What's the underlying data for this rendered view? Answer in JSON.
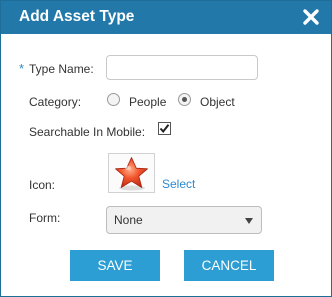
{
  "dialog": {
    "title": "Add Asset Type",
    "close_icon": "close-x-icon"
  },
  "form": {
    "type_name": {
      "required_marker": "*",
      "label": "Type Name:",
      "value": "",
      "placeholder": ""
    },
    "category": {
      "label": "Category:",
      "options": [
        {
          "label": "People",
          "checked": false
        },
        {
          "label": "Object",
          "checked": true
        }
      ]
    },
    "searchable": {
      "label": "Searchable In Mobile:",
      "checked": true
    },
    "icon": {
      "label": "Icon:",
      "preview_icon": "red-star-icon",
      "select_link": "Select"
    },
    "form_field": {
      "label": "Form:",
      "selected": "None"
    }
  },
  "buttons": {
    "save": "SAVE",
    "cancel": "CANCEL"
  },
  "colors": {
    "titlebar": "#2279a9",
    "button": "#2d9ed3",
    "link": "#2d8bd1",
    "required": "#2f88c5"
  }
}
